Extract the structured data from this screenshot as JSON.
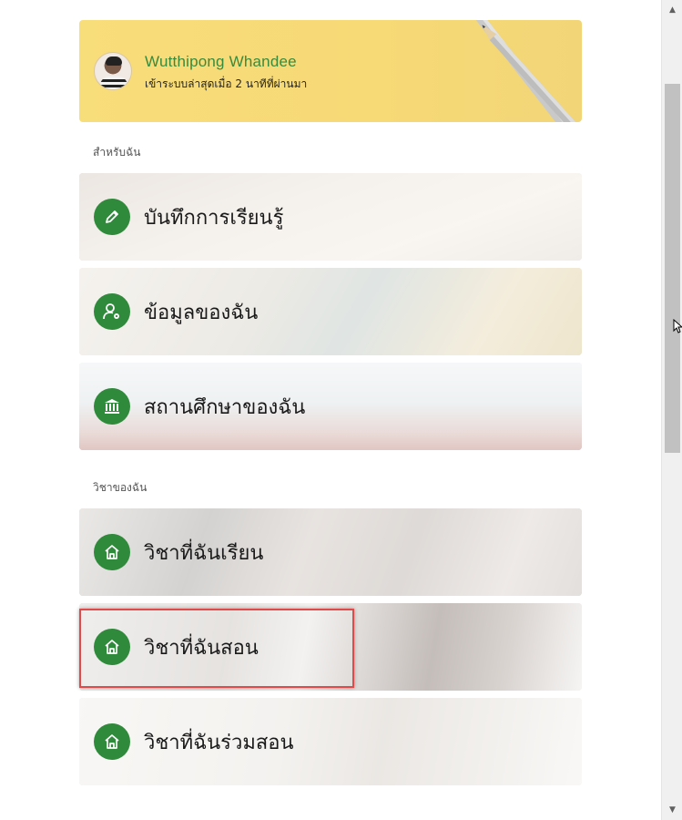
{
  "profile": {
    "name": "Wutthipong Whandee",
    "last_login": "เข้าระบบล่าสุดเมื่อ 2 นาทีที่ผ่านมา"
  },
  "sections": {
    "for_me": "สำหรับฉัน",
    "my_courses": "วิชาของฉัน"
  },
  "menu": {
    "learning_record": "บันทึกการเรียนรู้",
    "my_info": "ข้อมูลของฉัน",
    "my_institution": "สถานศึกษาของฉัน",
    "courses_i_study": "วิชาที่ฉันเรียน",
    "courses_i_teach": "วิชาที่ฉันสอน",
    "courses_i_coteach": "วิชาที่ฉันร่วมสอน"
  },
  "colors": {
    "accent_green": "#2f8a3b",
    "name_green": "#3a8a3c",
    "profile_bg": "#f8dd7b",
    "highlight_red": "#e24a4a"
  },
  "icons": {
    "learning_record": "pencil-icon",
    "my_info": "user-gear-icon",
    "my_institution": "institution-icon",
    "courses": "home-icon"
  }
}
